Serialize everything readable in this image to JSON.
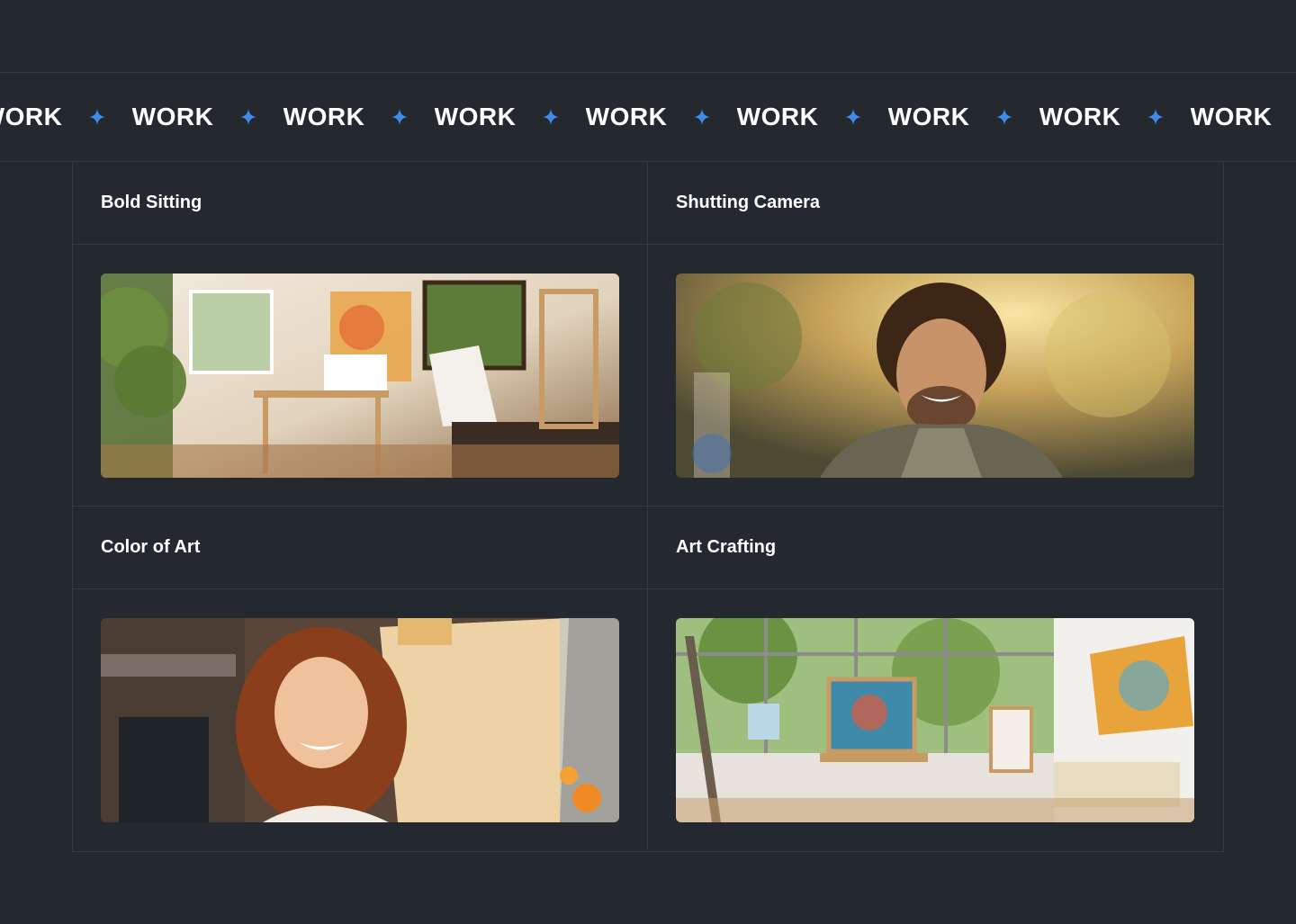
{
  "marquee": {
    "word": "WORK",
    "items": [
      "WORK",
      "WORK",
      "WORK",
      "WORK",
      "WORK",
      "WORK",
      "WORK",
      "WORK",
      "WORK"
    ],
    "accent_color": "#3b8bea",
    "separator_icon": "sparkle-star-icon"
  },
  "cards": [
    {
      "title": "Bold Sitting",
      "image": "art-studio-easels-photo"
    },
    {
      "title": "Shutting Camera",
      "image": "smiling-curly-haired-man-photo"
    },
    {
      "title": "Color of Art",
      "image": "smiling-woman-with-canvas-photo"
    },
    {
      "title": "Art Crafting",
      "image": "bright-art-studio-photo"
    }
  ],
  "theme": {
    "background": "#242930",
    "border": "#353b43",
    "text": "#ffffff"
  }
}
